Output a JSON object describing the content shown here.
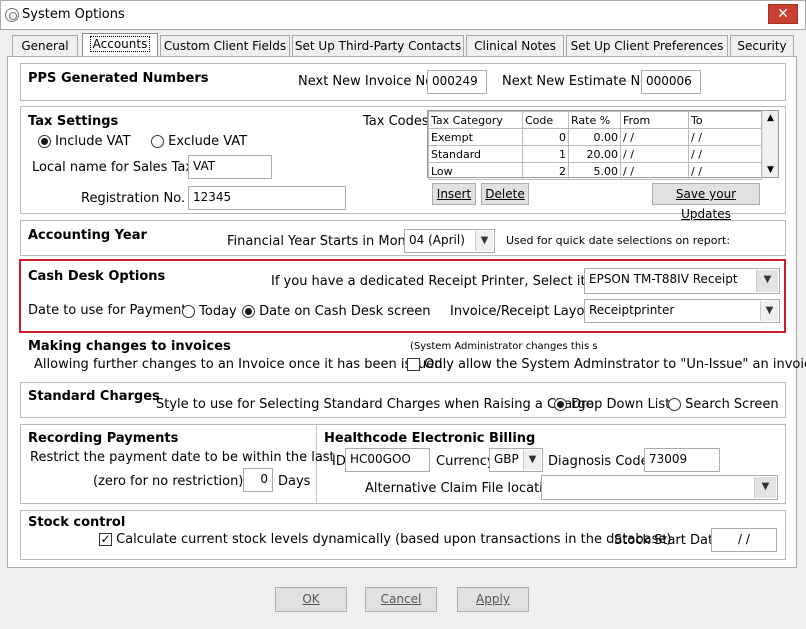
{
  "window": {
    "title": "System Options",
    "close": "✕"
  },
  "tabs": [
    "General",
    "Accounts",
    "Custom Client Fields",
    "Set Up Third-Party Contacts",
    "Clinical Notes",
    "Set Up Client Preferences",
    "Security"
  ],
  "pps": {
    "heading": "PPS Generated Numbers",
    "invoice_label": "Next New Invoice No.",
    "invoice_value": "000249",
    "estimate_label": "Next New Estimate No.",
    "estimate_value": "000006"
  },
  "tax": {
    "heading": "Tax Settings",
    "include": "Include VAT",
    "exclude": "Exclude VAT",
    "local_label": "Local name for Sales Tax",
    "local_value": "VAT",
    "reg_label": "Registration No.",
    "reg_value": "12345",
    "codes_label": "Tax Codes",
    "columns": [
      "Tax Category",
      "Code",
      "Rate %",
      "From",
      "To"
    ],
    "rows": [
      [
        "Exempt",
        "0",
        "0.00",
        "/  /",
        "/  /"
      ],
      [
        "Standard",
        "1",
        "20.00",
        "/  /",
        "/  /"
      ],
      [
        "Low",
        "2",
        "5.00",
        "/  /",
        "/  /"
      ]
    ],
    "insert": "Insert",
    "delete": "Delete",
    "save": "Save your Updates"
  },
  "accounting": {
    "heading": "Accounting Year",
    "fy_label": "Financial Year Starts in Month",
    "fy_value": "04 (April)",
    "note": "Used for quick date selections on report:"
  },
  "cash": {
    "heading": "Cash Desk Options",
    "printer_label": "If you have a dedicated Receipt Printer, Select it here:",
    "printer_value": "EPSON TM-T88IV Receipt",
    "date_label": "Date to use for Payments",
    "today": "Today",
    "cashdesk": "Date on Cash Desk screen",
    "layout_label": "Invoice/Receipt Layout",
    "layout_value": "Receiptprinter"
  },
  "changes": {
    "heading": "Making changes to invoices",
    "admin_note": "(System Administrator changes this s",
    "allow_label": "Allowing further changes to an Invoice once it has been issued:",
    "only_label": "Only allow the System Adminstrator to \"Un-Issue\" an invoice"
  },
  "standard": {
    "heading": "Standard Charges",
    "style_label": "Style to use for Selecting Standard Charges when Raising a Charge",
    "dropdown": "Drop Down List",
    "search": "Search Screen"
  },
  "recording": {
    "heading": "Recording Payments",
    "restrict": "Restrict the payment date to be within the last",
    "zero": "(zero for no restriction)",
    "days_value": "0",
    "days": "Days"
  },
  "healthcode": {
    "heading": "Healthcode Electronic Billing",
    "id_label": "ID",
    "id_value": "HC00GOO",
    "currency_label": "Currency",
    "currency_value": "GBP",
    "diag_label": "Diagnosis Code",
    "diag_value": "73009",
    "alt_label": "Alternative Claim File location",
    "alt_value": ""
  },
  "stock": {
    "heading": "Stock control",
    "calc": "Calculate current stock levels dynamically (based upon transactions in the database)",
    "start_label": "Stock Start Date",
    "start_value": "/  /"
  },
  "buttons": {
    "ok": "OK",
    "cancel": "Cancel",
    "apply": "Apply"
  }
}
